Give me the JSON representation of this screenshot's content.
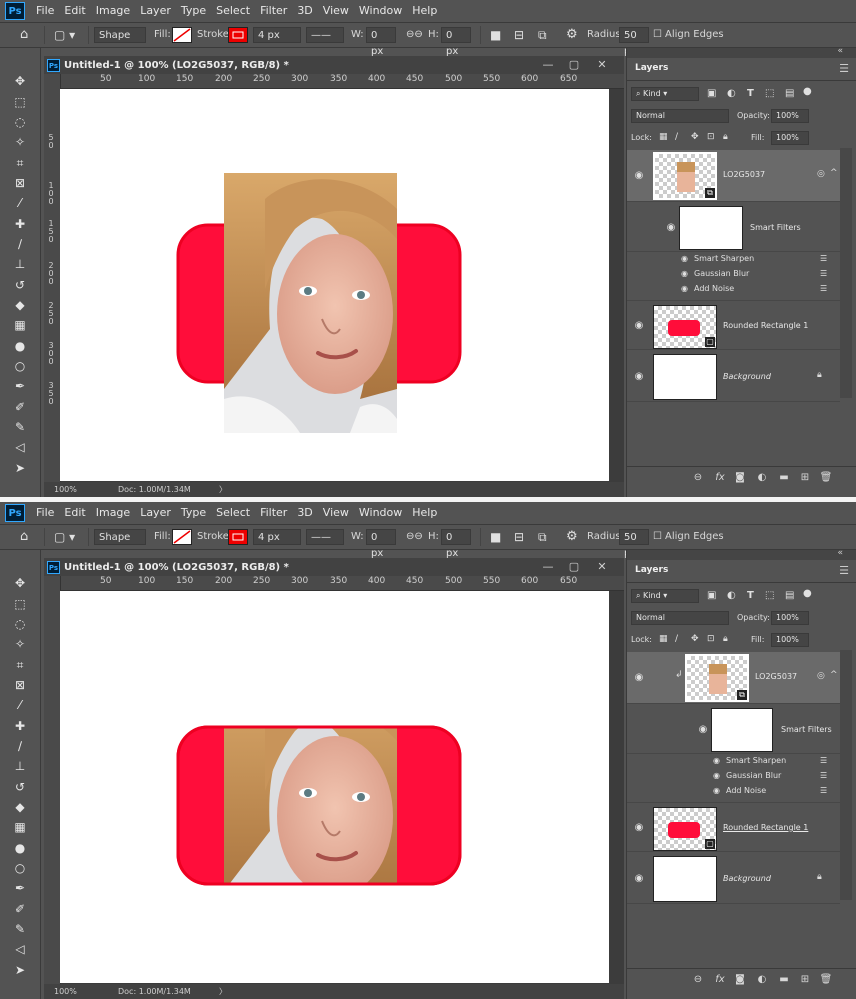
{
  "app": {
    "logo": "Ps"
  },
  "menu": [
    "File",
    "Edit",
    "Image",
    "Layer",
    "Type",
    "Select",
    "Filter",
    "3D",
    "View",
    "Window",
    "Help"
  ],
  "options": {
    "tool_mode": "Shape",
    "fill_label": "Fill:",
    "stroke_label": "Stroke:",
    "stroke_width": "4 px",
    "w_label": "W:",
    "w_value": "0 px",
    "h_label": "H:",
    "h_value": "0 px",
    "radius_label": "Radius:",
    "radius_value": "50 px",
    "align_edges": "Align Edges",
    "stroke_color": "#ff0000",
    "shape_fill": "#ff0d3a"
  },
  "tools": [
    "move-icon",
    "marquee-icon",
    "lasso-icon",
    "magic-wand-icon",
    "crop-icon",
    "frame-icon",
    "eyedropper-icon",
    "spot-healing-icon",
    "brush-icon",
    "clone-stamp-icon",
    "history-brush-icon",
    "eraser-icon",
    "gradient-icon",
    "blur-icon",
    "dodge-icon",
    "pen-icon",
    "type-icon",
    "path-select-icon",
    "shape-icon",
    "hand-icon"
  ],
  "document": {
    "title": "Untitled-1 @ 100% (LO2G5037, RGB/8) *",
    "zoom": "100%",
    "doc_size": "Doc: 1.00M/1.34M",
    "ruler_ticks": [
      "50",
      "100",
      "150",
      "200",
      "250",
      "300",
      "350",
      "400",
      "450",
      "500",
      "550",
      "600",
      "650"
    ],
    "ruler_v_ticks": [
      "5\n0",
      "1\n0\n0",
      "1\n5\n0",
      "2\n0\n0",
      "2\n5\n0",
      "3\n0\n0",
      "3\n5\n0"
    ]
  },
  "panel": {
    "title": "Layers",
    "kind": "Kind",
    "blend": "Normal",
    "opacity_label": "Opacity:",
    "opacity": "100%",
    "lock_label": "Lock:",
    "fill_label": "Fill:",
    "fill": "100%",
    "layers": {
      "photo": "LO2G5037",
      "smart_filters": "Smart Filters",
      "filters": [
        "Smart Sharpen",
        "Gaussian Blur",
        "Add Noise"
      ],
      "rect": "Rounded Rectangle 1",
      "background": "Background"
    }
  },
  "screenshots": [
    {
      "state": "before",
      "clipped": false
    },
    {
      "state": "after",
      "clipped": true
    }
  ]
}
